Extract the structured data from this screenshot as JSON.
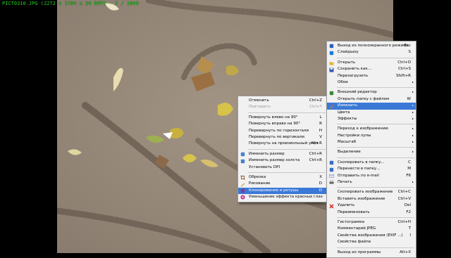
{
  "window": {
    "info_text": "PICT0310.JPG  (2272 x 1704 x 24 BPP)  -  7  /  1048"
  },
  "main_menu": [
    {
      "label": "Выход из полноэкранного режима",
      "shortcut": "Esc",
      "icon": "exit-fullscreen-icon",
      "color": "#2b5fbf"
    },
    {
      "label": "Слайдшоу",
      "shortcut": "S",
      "icon": "slideshow-icon",
      "color": "#1f7ad6"
    },
    "-",
    {
      "label": "Открыть",
      "shortcut": "Ctrl+O",
      "icon": "open-folder-icon",
      "color": "#e6b335"
    },
    {
      "label": "Сохранить как...",
      "shortcut": "Ctrl+S",
      "icon": "save-icon",
      "color": "#3555b5"
    },
    {
      "label": "Перезагрузить",
      "shortcut": "Shift+R"
    },
    {
      "label": "Обои",
      "submenu": true
    },
    "-",
    {
      "label": "Внешний редактор",
      "submenu": true,
      "icon": "external-editor-icon",
      "color": "#3a8a3a"
    },
    {
      "label": "Открыть папку с файлом",
      "shortcut": "W"
    },
    {
      "label": "Изменить",
      "submenu": true,
      "highlighted": true,
      "icon": "edit-icon",
      "color": "#c98a2a"
    },
    {
      "label": "Цвета",
      "submenu": true
    },
    {
      "label": "Эффекты",
      "submenu": true
    },
    "-",
    {
      "label": "Переход к изображению",
      "submenu": true
    },
    {
      "label": "Настройки лупы",
      "submenu": true
    },
    {
      "label": "Масштаб",
      "submenu": true
    },
    "-",
    {
      "label": "Выделение",
      "submenu": true
    },
    "-",
    {
      "label": "Скопировать в папку...",
      "shortcut": "C",
      "icon": "copy-to-folder-icon",
      "color": "#3a6fc2"
    },
    {
      "label": "Перенести в папку...",
      "shortcut": "M",
      "icon": "move-to-folder-icon",
      "color": "#3a6fc2"
    },
    {
      "label": "Отправить по e-mail",
      "shortcut": "F6",
      "icon": "email-icon",
      "color": "#6d88b8"
    },
    {
      "label": "Печать",
      "submenu": true,
      "icon": "print-icon",
      "color": "#606060"
    },
    "-",
    {
      "label": "Скопировать изображение",
      "shortcut": "Ctrl+C"
    },
    {
      "label": "Вставить изображение",
      "shortcut": "Ctrl+V"
    },
    {
      "label": "Удалить",
      "shortcut": "Del",
      "icon": "delete-icon",
      "color": "#d42020"
    },
    {
      "label": "Переименовать",
      "shortcut": "F2"
    },
    "-",
    {
      "label": "Гистограмма",
      "shortcut": "Ctrl+H"
    },
    {
      "label": "Комментарий JPEG",
      "shortcut": "T"
    },
    {
      "label": "Свойства изображения (EXIF ...)",
      "shortcut": "I"
    },
    {
      "label": "Свойства файла"
    },
    "-",
    {
      "label": "Выход из программы",
      "shortcut": "Alt+X"
    }
  ],
  "edit_submenu": [
    {
      "label": "Отменить",
      "shortcut": "Ctrl+Z"
    },
    {
      "label": "Повторить",
      "shortcut": "Ctrl+Y",
      "disabled": true
    },
    "-",
    {
      "label": "Повернуть влево на 90°",
      "shortcut": "L"
    },
    {
      "label": "Повернуть вправо на 90°",
      "shortcut": "R"
    },
    {
      "label": "Перевернуть по горизонтали",
      "shortcut": "H"
    },
    {
      "label": "Перевернуть по вертикали",
      "shortcut": "V"
    },
    {
      "label": "Повернуть на произвольный угол",
      "shortcut": "Alt+R"
    },
    "-",
    {
      "label": "Изменить размер",
      "shortcut": "Ctrl+R",
      "icon": "resize-icon",
      "color": "#4a7fcf"
    },
    {
      "label": "Изменить размер холста",
      "shortcut": "Ctrl+R",
      "icon": "canvas-size-icon",
      "color": "#4a7fcf"
    },
    {
      "label": "Установить DPI"
    },
    "-",
    {
      "label": "Обрезка",
      "shortcut": "X",
      "icon": "crop-icon",
      "color": "#8a5a2a"
    },
    {
      "label": "Рисование",
      "shortcut": "D",
      "icon": "draw-icon",
      "color": "#d88a1a"
    },
    {
      "label": "Клонирование и ретушь",
      "shortcut": "O",
      "highlighted": true,
      "icon": "clone-retouch-icon",
      "color": "#7a3fa0"
    },
    {
      "label": "Уменьшение эффекта красных глаз",
      "icon": "red-eye-icon",
      "color": "#c02090"
    }
  ]
}
